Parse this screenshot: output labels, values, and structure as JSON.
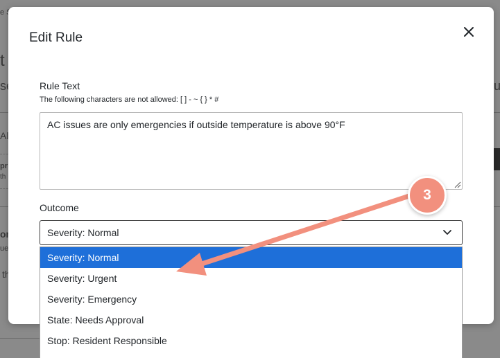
{
  "background": {
    "fragments": [
      "e S",
      "t",
      "se",
      "All",
      "pr",
      "th",
      "on",
      "ue",
      "th",
      "ut"
    ]
  },
  "modal": {
    "title": "Edit Rule",
    "close_icon": "close-icon",
    "rule_text": {
      "label": "Rule Text",
      "help": "The following characters are not allowed: [ ] - ~ { } * #",
      "value": "AC issues are only emergencies if outside temperature is above 90°F"
    },
    "outcome": {
      "label": "Outcome",
      "selected": "Severity: Normal",
      "options": [
        "Severity: Normal",
        "Severity: Urgent",
        "Severity: Emergency",
        "State: Needs Approval",
        "Stop: Resident Responsible"
      ],
      "highlighted_index": 0
    }
  },
  "annotation": {
    "step_number": "3",
    "color": "#f2907e"
  },
  "colors": {
    "selected_option": "#1e6fd9",
    "annotation": "#f2907e"
  }
}
